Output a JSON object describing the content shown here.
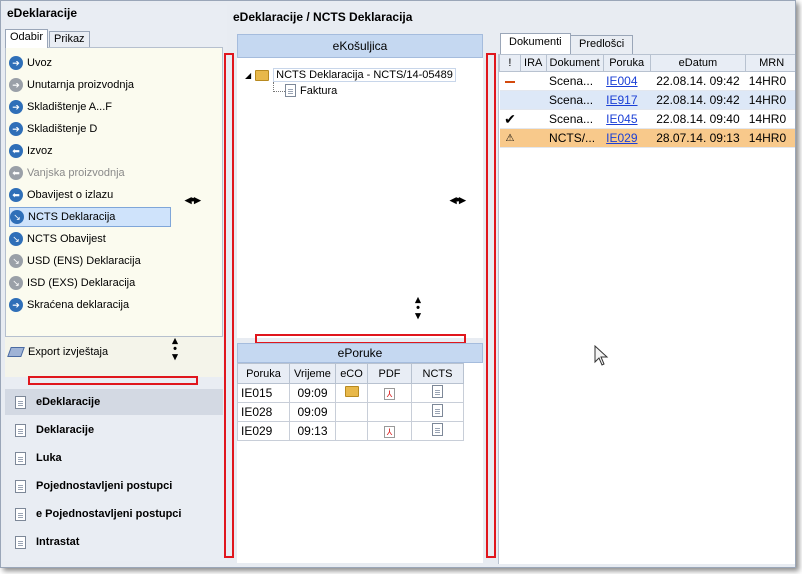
{
  "app_title": "eDeklaracije",
  "left_tabs": [
    "Odabir",
    "Prikaz"
  ],
  "menu": [
    {
      "label": "Uvoz",
      "icon": "arrow-right-icon",
      "state": "normal"
    },
    {
      "label": "Unutarnja proizvodnja",
      "icon": "arrow-right-grey-icon",
      "state": "normal"
    },
    {
      "label": "Skladištenje A...F",
      "icon": "arrow-right-icon",
      "state": "normal"
    },
    {
      "label": "Skladištenje D",
      "icon": "arrow-right-icon",
      "state": "normal"
    },
    {
      "label": "Izvoz",
      "icon": "arrow-left-icon",
      "state": "normal"
    },
    {
      "label": "Vanjska proizvodnja",
      "icon": "arrow-left-grey-icon",
      "state": "disabled"
    },
    {
      "label": "Obavijest o izlazu",
      "icon": "arrow-left-icon",
      "state": "normal"
    },
    {
      "label": "NCTS Deklaracija",
      "icon": "arrow-down-right-icon",
      "state": "selected"
    },
    {
      "label": "NCTS Obavijest",
      "icon": "arrow-down-right-icon",
      "state": "normal"
    },
    {
      "label": "USD (ENS) Deklaracija",
      "icon": "arrow-down-right-grey-icon",
      "state": "normal"
    },
    {
      "label": "ISD (EXS) Deklaracija",
      "icon": "arrow-down-right-grey-icon",
      "state": "normal"
    },
    {
      "label": "Skraćena deklaracija",
      "icon": "arrow-right-icon",
      "state": "normal"
    }
  ],
  "export_label": "Export izvještaja",
  "nav": [
    "eDeklaracije",
    "Deklaracije",
    "Luka",
    "Pojednostavljeni postupci",
    "e Pojednostavljeni postupci",
    "Intrastat"
  ],
  "middle_title": "eDeklaracije / NCTS Deklaracija",
  "ekosuljica": {
    "title": "eKošuljica",
    "root": "NCTS Deklaracija - NCTS/14-05489",
    "child": "Faktura"
  },
  "eporuke": {
    "title": "ePoruke",
    "columns": [
      "Poruka",
      "Vrijeme",
      "eCO",
      "PDF",
      "NCTS"
    ],
    "rows": [
      {
        "poruka": "IE015",
        "vrijeme": "09:09",
        "eco": true,
        "pdf": true,
        "ncts": true
      },
      {
        "poruka": "IE028",
        "vrijeme": "09:09",
        "eco": false,
        "pdf": false,
        "ncts": true
      },
      {
        "poruka": "IE029",
        "vrijeme": "09:13",
        "eco": false,
        "pdf": true,
        "ncts": true
      }
    ]
  },
  "right_tabs": [
    "Dokumenti",
    "Predlošci"
  ],
  "docs": {
    "columns": [
      "!",
      "IRA",
      "Dokument",
      "Poruka",
      "eDatum",
      "MRN"
    ],
    "rows": [
      {
        "status": "dash",
        "ira": "",
        "dokument": "Scena...",
        "poruka": "IE004",
        "edatum": "22.08.14. 09:42",
        "mrn": "14HR0",
        "style": "normal"
      },
      {
        "status": "",
        "ira": "",
        "dokument": "Scena...",
        "poruka": "IE917",
        "edatum": "22.08.14. 09:42",
        "mrn": "14HR0",
        "style": "alt"
      },
      {
        "status": "check",
        "ira": "",
        "dokument": "Scena...",
        "poruka": "IE045",
        "edatum": "22.08.14. 09:40",
        "mrn": "14HR0",
        "style": "normal"
      },
      {
        "status": "warn",
        "ira": "",
        "dokument": "NCTS/...",
        "poruka": "IE029",
        "edatum": "28.07.14. 09:13",
        "mrn": "14HR0",
        "style": "sel"
      }
    ]
  },
  "colors": {
    "highlight_red": "#e0161d",
    "selected_row": "#f8c98b",
    "header_blue": "#c5d8f1"
  }
}
